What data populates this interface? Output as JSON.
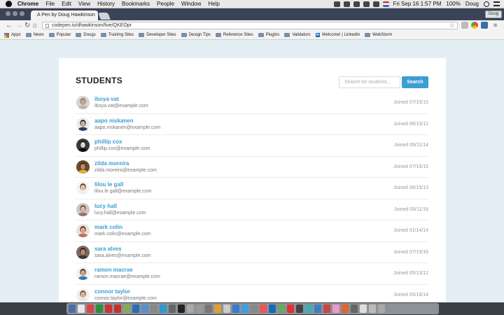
{
  "menubar": {
    "app": "Chrome",
    "items": [
      "File",
      "Edit",
      "View",
      "History",
      "Bookmarks",
      "People",
      "Window",
      "Help"
    ],
    "clock": "Fri Sep 16  1:57 PM",
    "battery": "100%",
    "user": "Doug"
  },
  "browser": {
    "tab_title": "A Pen by Doug Hawkinson",
    "tab_close": "×",
    "profile": "Doug",
    "url": "codepen.io/dhawkinson/live/QKEOpr",
    "bookmarks": [
      "Apps",
      "News",
      "Popular",
      "Dougs",
      "Training Sites",
      "Developer Sites",
      "Design Tips",
      "Reference Sites",
      "Plugins",
      "Validators",
      "Welcome! | LinkedIn",
      "WebStorm"
    ],
    "linkedin_badge": "in"
  },
  "page": {
    "title": "STUDENTS",
    "search_placeholder": "Search for students...",
    "search_button": "Search",
    "students": [
      {
        "name": "iboya vat",
        "email": "iboya.vat@example.com",
        "joined": "Joined 07/15/15",
        "skin": "#c9a48b",
        "hair": "#8a7a70",
        "shirt": "#b7b7b7",
        "bg": "#d8d4d0"
      },
      {
        "name": "aapo niskanen",
        "email": "aapo.niskanen@example.com",
        "joined": "Joined 06/15/12",
        "skin": "#d2a98c",
        "hair": "#2a2a2a",
        "shirt": "#2c3e66",
        "bg": "#e6eef4"
      },
      {
        "name": "phillip cox",
        "email": "phillip.cox@example.com",
        "joined": "Joined 09/11/14",
        "skin": "#d8d8d8",
        "hair": "#1b1b1b",
        "shirt": "#111111",
        "bg": "#3a3a3a"
      },
      {
        "name": "zilda moreira",
        "email": "zilda.moreira@example.com",
        "joined": "Joined 07/15/15",
        "skin": "#b98b66",
        "hair": "#3a2414",
        "shirt": "#e0b040",
        "bg": "#6b4a2d"
      },
      {
        "name": "lilou le gall",
        "email": "lilou.le gall@example.com",
        "joined": "Joined 06/15/13",
        "skin": "#e2c2aa",
        "hair": "#5a3a22",
        "shirt": "#f0f0f0",
        "bg": "#f4f4f4"
      },
      {
        "name": "lucy hall",
        "email": "lucy.hall@example.com",
        "joined": "Joined 09/11/16",
        "skin": "#dab79e",
        "hair": "#6e4a32",
        "shirt": "#8a7a70",
        "bg": "#cfc8c2"
      },
      {
        "name": "mark colin",
        "email": "mark.colin@example.com",
        "joined": "Joined 01/14/14",
        "skin": "#d9aa8e",
        "hair": "#5a3020",
        "shirt": "#c86a5a",
        "bg": "#e8e2dc"
      },
      {
        "name": "sara alves",
        "email": "sara.alves@example.com",
        "joined": "Joined 07/19/16",
        "skin": "#b8886a",
        "hair": "#2a1a12",
        "shirt": "#3a3a3a",
        "bg": "#7a6a60"
      },
      {
        "name": "ramon macrae",
        "email": "ramon.macrae@example.com",
        "joined": "Joined 05/13/12",
        "skin": "#d4a482",
        "hair": "#4a2e20",
        "shirt": "#3a7aa8",
        "bg": "#eef2f6"
      },
      {
        "name": "connor taylor",
        "email": "connor.taylor@example.com",
        "joined": "Joined 05/18/14",
        "skin": "#dcb094",
        "hair": "#6a4a30",
        "shirt": "#e8e8e8",
        "bg": "#f0f0f0"
      }
    ]
  },
  "dock": {
    "icons": [
      "#4a6fa5",
      "#e8e8e8",
      "#d44",
      "#2a8f3a",
      "#c33",
      "#c9302c",
      "#8a5",
      "#2a6fb0",
      "#5a8fd0",
      "#888",
      "#39c",
      "#666",
      "#222",
      "#aaa",
      "#999",
      "#777",
      "#e0a030",
      "#ccc",
      "#3a7acc",
      "#3aa0e0",
      "#888",
      "#e55",
      "#1a6bb5",
      "#6a6",
      "#d33",
      "#444",
      "#4ab",
      "#3a80c0",
      "#c44",
      "#e9c",
      "#d63",
      "#666",
      "#ddd",
      "#bbb",
      "#aaa"
    ]
  }
}
